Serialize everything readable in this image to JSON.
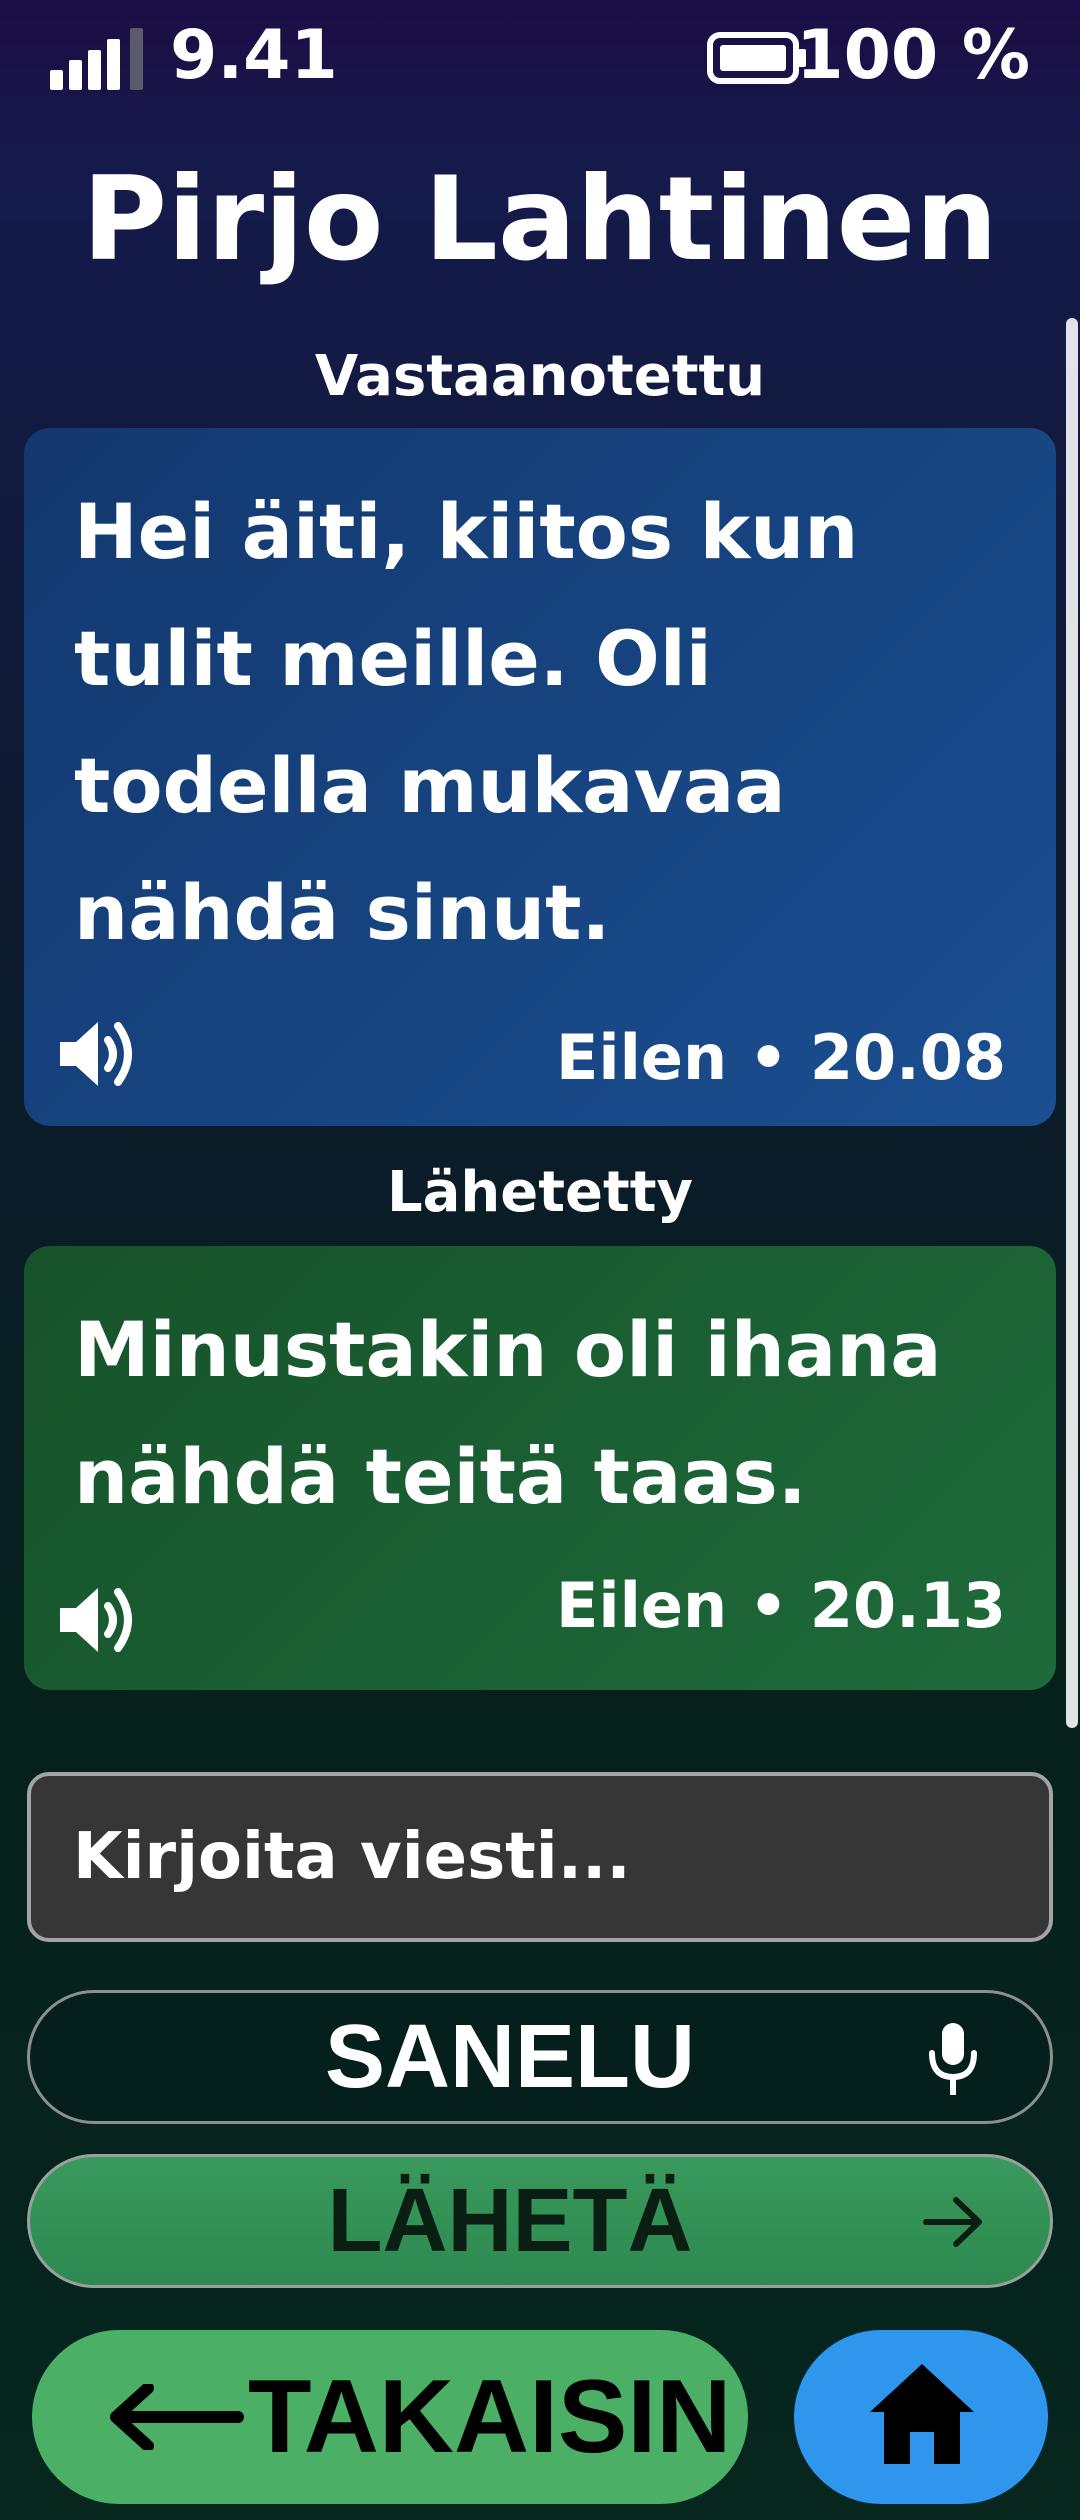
{
  "status_bar": {
    "time": "9.41",
    "battery_percent": "100 %",
    "signal_icon": "signal-bars-icon",
    "battery_icon": "battery-icon"
  },
  "conversation": {
    "contact_name": "Pirjo Lahtinen",
    "messages": [
      {
        "label": "Vastaanotettu",
        "text": "Hei äiti, kiitos kun tulit meille. Oli todella mukavaa nähdä sinut.",
        "time": "Eilen • 20.08",
        "icon": "speaker-icon"
      },
      {
        "label": "Lähetetty",
        "text": "Minustakin oli ihana nähdä teitä taas.",
        "time": "Eilen • 20.13",
        "icon": "speaker-icon"
      }
    ]
  },
  "composer": {
    "placeholder": "Kirjoita viesti...",
    "dictate_label": "SANELU",
    "send_label": "LÄHETÄ"
  },
  "nav": {
    "back_label": "TAKAISIN",
    "home_icon": "home-icon"
  },
  "colors": {
    "received_bubble": "#174683",
    "sent_bubble": "#1a6034",
    "back_button": "#4caf66",
    "home_button": "#2f96ee",
    "send_button": "#2d8950"
  }
}
